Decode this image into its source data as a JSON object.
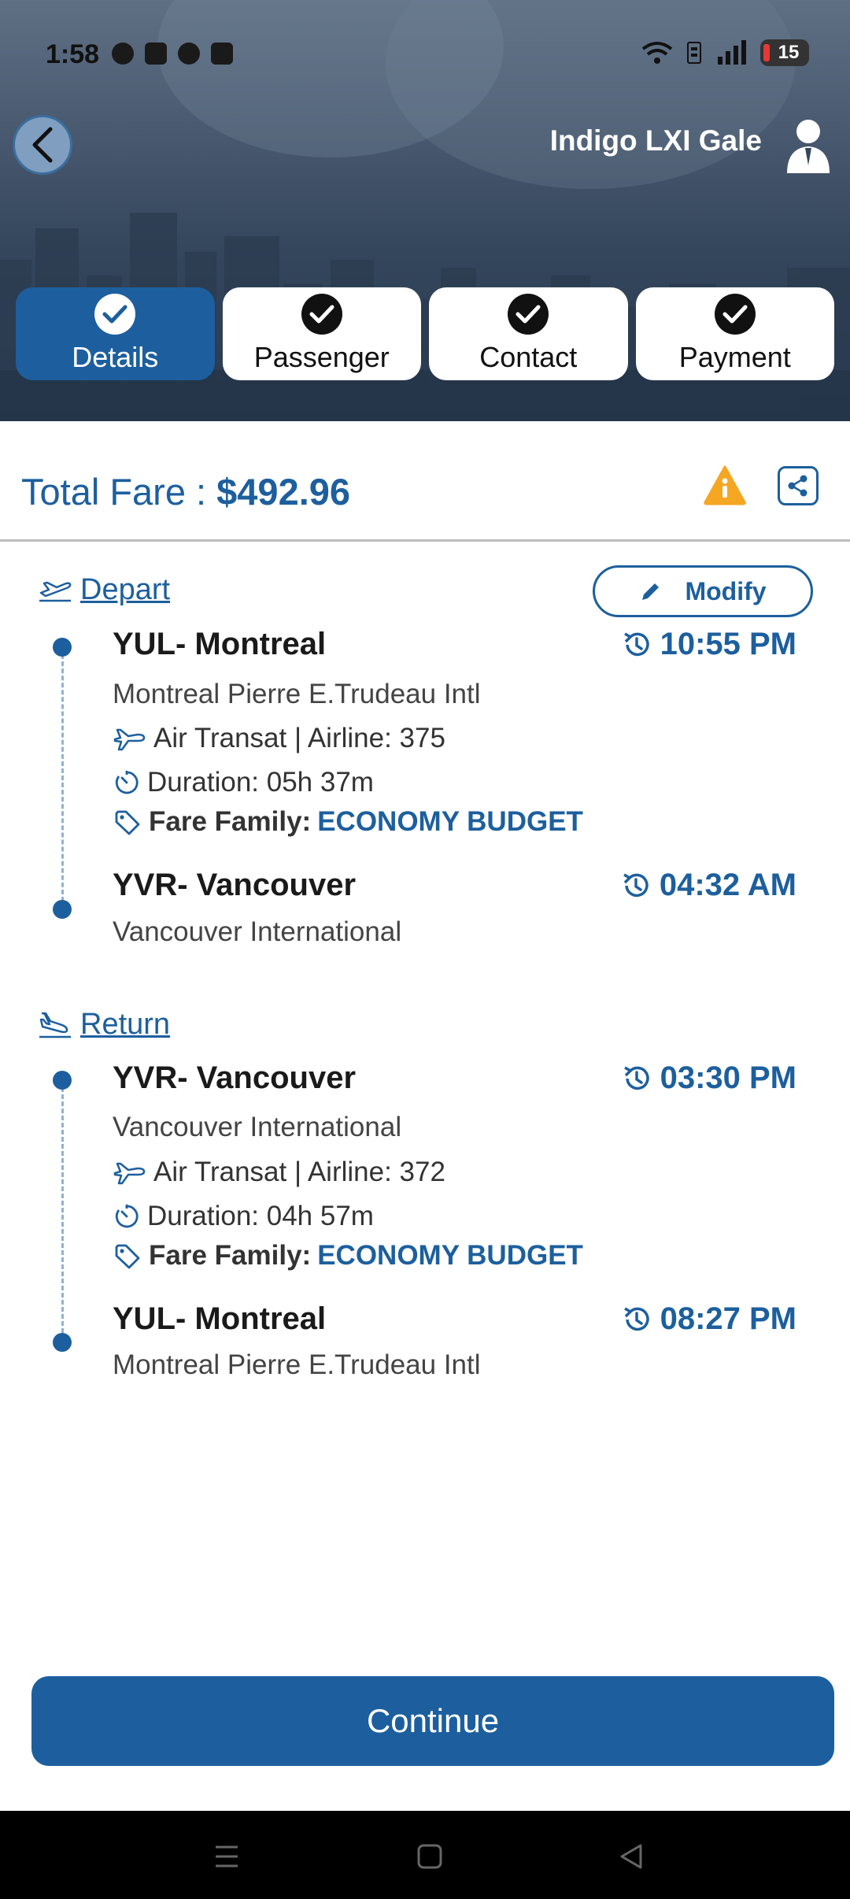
{
  "status_bar": {
    "time": "1:58",
    "battery": "15"
  },
  "header": {
    "title": "Indigo LXI Gale"
  },
  "steps": [
    {
      "label": "Details",
      "active": true
    },
    {
      "label": "Passenger",
      "active": false
    },
    {
      "label": "Contact",
      "active": false
    },
    {
      "label": "Payment",
      "active": false
    }
  ],
  "fare": {
    "label": "Total Fare : ",
    "value": "$492.96"
  },
  "modify_label": "Modify",
  "depart": {
    "heading": "Depart",
    "origin": {
      "city": "YUL- Montreal",
      "airport": "Montreal Pierre E.Trudeau Intl",
      "time": "10:55 PM"
    },
    "airline": "Air Transat | Airline: 375",
    "duration": "Duration: 05h 37m",
    "fare_family_label": "Fare Family:",
    "fare_family_value": "ECONOMY BUDGET",
    "destination": {
      "city": "YVR- Vancouver",
      "airport": "Vancouver International",
      "time": "04:32 AM"
    }
  },
  "return": {
    "heading": "Return",
    "origin": {
      "city": "YVR- Vancouver",
      "airport": "Vancouver International",
      "time": "03:30 PM"
    },
    "airline": "Air Transat | Airline: 372",
    "duration": "Duration: 04h 57m",
    "fare_family_label": "Fare Family:",
    "fare_family_value": "ECONOMY BUDGET",
    "destination": {
      "city": "YUL- Montreal",
      "airport": "Montreal Pierre E.Trudeau Intl",
      "time": "08:27 PM"
    }
  },
  "continue_label": "Continue",
  "colors": {
    "primary": "#1d5f9e",
    "warning": "#f5a623",
    "timeline": "#8fb2d3"
  },
  "icons": [
    "back-arrow-icon",
    "user-icon",
    "check-icon",
    "warning-icon",
    "share-icon",
    "takeoff-icon",
    "landing-icon",
    "pencil-icon",
    "clock-history-icon",
    "plane-icon",
    "timer-icon",
    "tag-icon"
  ]
}
